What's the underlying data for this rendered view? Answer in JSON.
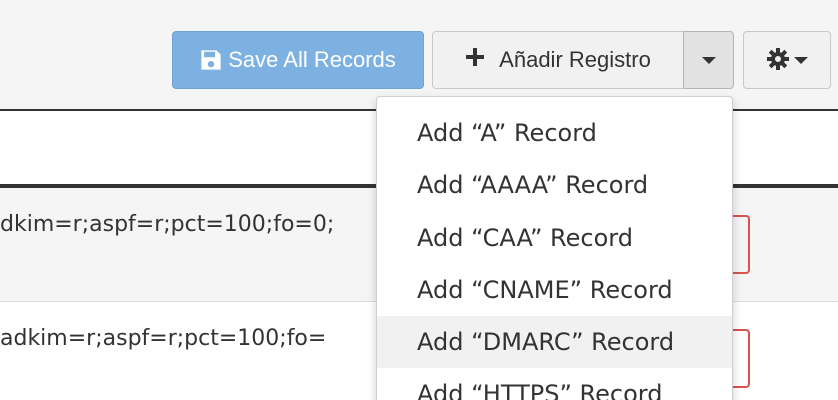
{
  "toolbar": {
    "save_label": "Save All Records",
    "add_label": "Añadir Registro"
  },
  "records": [
    {
      "value": "dkim=r;aspf=r;pct=100;fo=0;"
    },
    {
      "value": "adkim=r;aspf=r;pct=100;fo="
    }
  ],
  "add_menu": {
    "items": [
      {
        "label": "Add “A” Record"
      },
      {
        "label": "Add “AAAA” Record"
      },
      {
        "label": "Add “CAA” Record"
      },
      {
        "label": "Add “CNAME” Record"
      },
      {
        "label": "Add “DMARC” Record",
        "highlighted": true
      },
      {
        "label": "Add “HTTPS” Record"
      }
    ]
  },
  "icons": {
    "save": "floppy-disk-icon",
    "add": "plus-icon",
    "caret": "caret-down-icon",
    "settings": "gear-icon"
  },
  "colors": {
    "save_button": "#7cb1e1",
    "error_border": "#d9534f",
    "table_rule": "#333333"
  }
}
